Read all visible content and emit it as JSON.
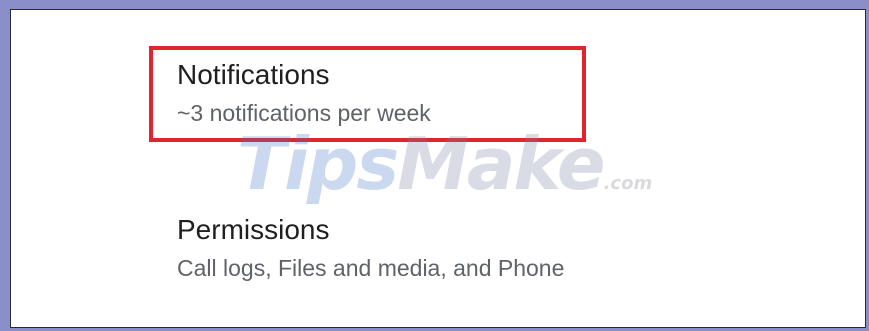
{
  "settings": {
    "notifications": {
      "title": "Notifications",
      "summary": "~3 notifications per week"
    },
    "permissions": {
      "title": "Permissions",
      "summary": "Call logs, Files and media, and Phone"
    }
  },
  "watermark": {
    "part1": "Tips",
    "part2": "Make",
    "suffix": ".com"
  },
  "colors": {
    "highlight_border": "#e0262d",
    "outer_border": "#8b8fc9",
    "title_text": "#1f1f1f",
    "summary_text": "#5f6368"
  }
}
